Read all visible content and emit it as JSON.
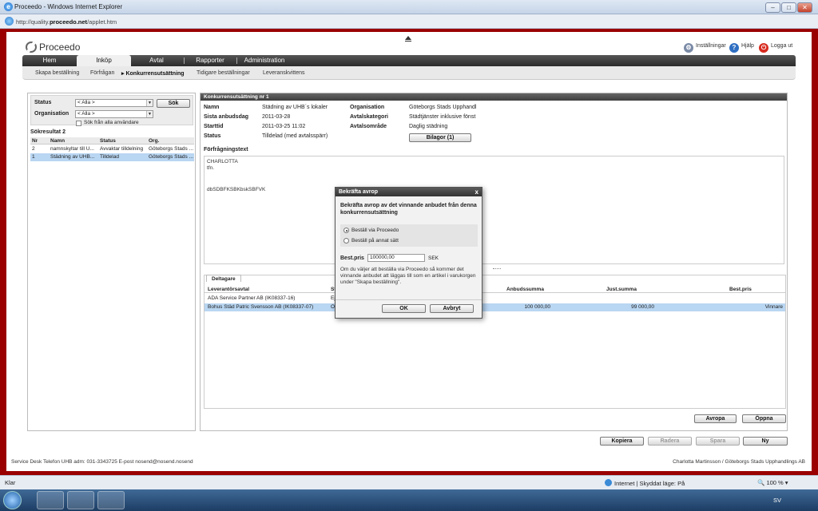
{
  "browser": {
    "title": "Proceedo - Windows Internet Explorer",
    "url_prefix": "http://quality.",
    "url_domain": "proceedo.net",
    "url_suffix": "/applet.htm"
  },
  "app": {
    "logo_text": "Proceedo",
    "top_links": {
      "settings": "Inställningar",
      "help": "Hjälp",
      "logout": "Logga ut"
    },
    "nav": [
      "Hem",
      "Inköp",
      "Avtal",
      "Rapporter",
      "Administration"
    ],
    "active_nav": "Inköp",
    "subnav": [
      "Skapa beställning",
      "Förfrågan",
      "Konkurrensutsättning",
      "Tidigare beställningar",
      "Leveranskvittens"
    ],
    "active_subnav": "Konkurrensutsättning"
  },
  "search": {
    "status_label": "Status",
    "status_value": "< Alla >",
    "org_label": "Organisation",
    "org_value": "< Alla >",
    "search_button": "Sök",
    "all_users_label": "Sök från alla användare",
    "result_title": "Sökresultat 2",
    "columns": [
      "Nr",
      "Namn",
      "Status",
      "Org."
    ],
    "rows": [
      {
        "nr": "2",
        "namn": "namnskyltar till U...",
        "status": "Avvaktar tilldelning",
        "org": "Göteborgs Stads ..."
      },
      {
        "nr": "1",
        "namn": "Städning av UHB...",
        "status": "Tilldelad",
        "org": "Göteborgs Stads ..."
      }
    ]
  },
  "detail": {
    "header": "Konkurrensutsättning nr 1",
    "fields_left": [
      {
        "label": "Namn",
        "value": "Städning av UHB´s lokaler"
      },
      {
        "label": "Sista anbudsdag",
        "value": "2011-03-28"
      },
      {
        "label": "Starttid",
        "value": "2011-03-25 11:02"
      },
      {
        "label": "Status",
        "value": "Tilldelad (med avtalsspärr)"
      }
    ],
    "fields_right": [
      {
        "label": "Organisation",
        "value": "Göteborgs Stads Upphandl"
      },
      {
        "label": "Avtalskategori",
        "value": "Städtjänster inklusive fönst"
      },
      {
        "label": "Avtalsområde",
        "value": "Daglig städning"
      }
    ],
    "attachments_button": "Bilagor (1)",
    "request_text_label": "Förfrågningstext",
    "request_text_lines": [
      "CHARLOTTA",
      "tfn.",
      "dbSDBFKSBKbskSBFVK"
    ],
    "participants_tab": "Deltagare",
    "participants_columns": [
      "Leverantörsavtal",
      "St",
      "Anbudssumma",
      "Just.summa",
      "Best.pris"
    ],
    "participants": [
      {
        "supplier": "ADA Service Partner AB (IK08337-16)",
        "status": "Ej",
        "bid": "",
        "adjusted": "",
        "order_price": ""
      },
      {
        "supplier": "Bohus Städ Patric Svensson AB (IK08337-07)",
        "status": "Öp",
        "bid": "100 000,00",
        "adjusted": "99 000,00",
        "order_price": "Vinnare"
      }
    ],
    "actions": {
      "avropa": "Avropa",
      "oppna": "Öppna",
      "kopiera": "Kopiera",
      "radera": "Radera",
      "spara": "Spara",
      "ny": "Ny"
    }
  },
  "modal": {
    "title": "Bekräfta avrop",
    "close": "x",
    "question": "Bekräfta avrop av det vinnande anbudet från denna konkurrensutsättning",
    "option1": "Beställ via Proceedo",
    "option2": "Beställ på annat sätt",
    "price_label": "Best.pris",
    "price_value": "100000,00",
    "currency": "SEK",
    "info": "Om du väljer att beställa via Proceedo så kommer det vinnande anbudet att läggas till som en artikel i varukorgen under \"Skapa beställning\".",
    "ok": "OK",
    "cancel": "Avbryt"
  },
  "footer": {
    "left": "Service Desk Telefon UHB adm: 031-3343725   E-post nosend@nosend.nosend",
    "right": "Charlotta Martinsson / Göteborgs Stads Upphandlings AB"
  },
  "statusbar": {
    "left": "Klar",
    "zone": "Internet | Skyddat läge: På",
    "zoom": "100 %"
  },
  "taskbar": {
    "lang": "SV"
  }
}
